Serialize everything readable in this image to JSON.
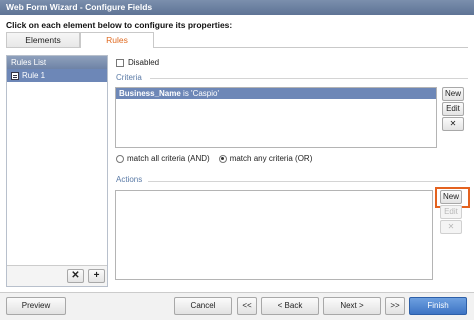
{
  "window": {
    "title": "Web Form Wizard - Configure Fields"
  },
  "instruction": "Click on each element below to configure its properties:",
  "tabs": [
    {
      "label": "Elements",
      "active": false
    },
    {
      "label": "Rules",
      "active": true
    }
  ],
  "rules_list": {
    "header": "Rules List",
    "items": [
      {
        "label": "Rule 1",
        "selected": true
      }
    ],
    "delete_icon": "close-icon",
    "add_icon": "plus-icon"
  },
  "disabled_checkbox": {
    "label": "Disabled",
    "checked": false
  },
  "criteria": {
    "label": "Criteria",
    "rows": [
      {
        "field": "Business_Name",
        "text": " is 'Caspio'"
      }
    ],
    "buttons": {
      "new": "New",
      "edit": "Edit",
      "delete": "✕"
    },
    "match": {
      "all_label": "match all criteria (AND)",
      "any_label": "match any criteria (OR)",
      "selected": "any"
    }
  },
  "actions": {
    "label": "Actions",
    "buttons": {
      "new": "New",
      "edit": "Edit",
      "delete": "✕"
    },
    "highlight_color": "#e4621f"
  },
  "footer": {
    "preview": "Preview",
    "cancel": "Cancel",
    "first": "<<",
    "back": "< Back",
    "next": "Next >",
    "last": ">>",
    "finish": "Finish"
  }
}
